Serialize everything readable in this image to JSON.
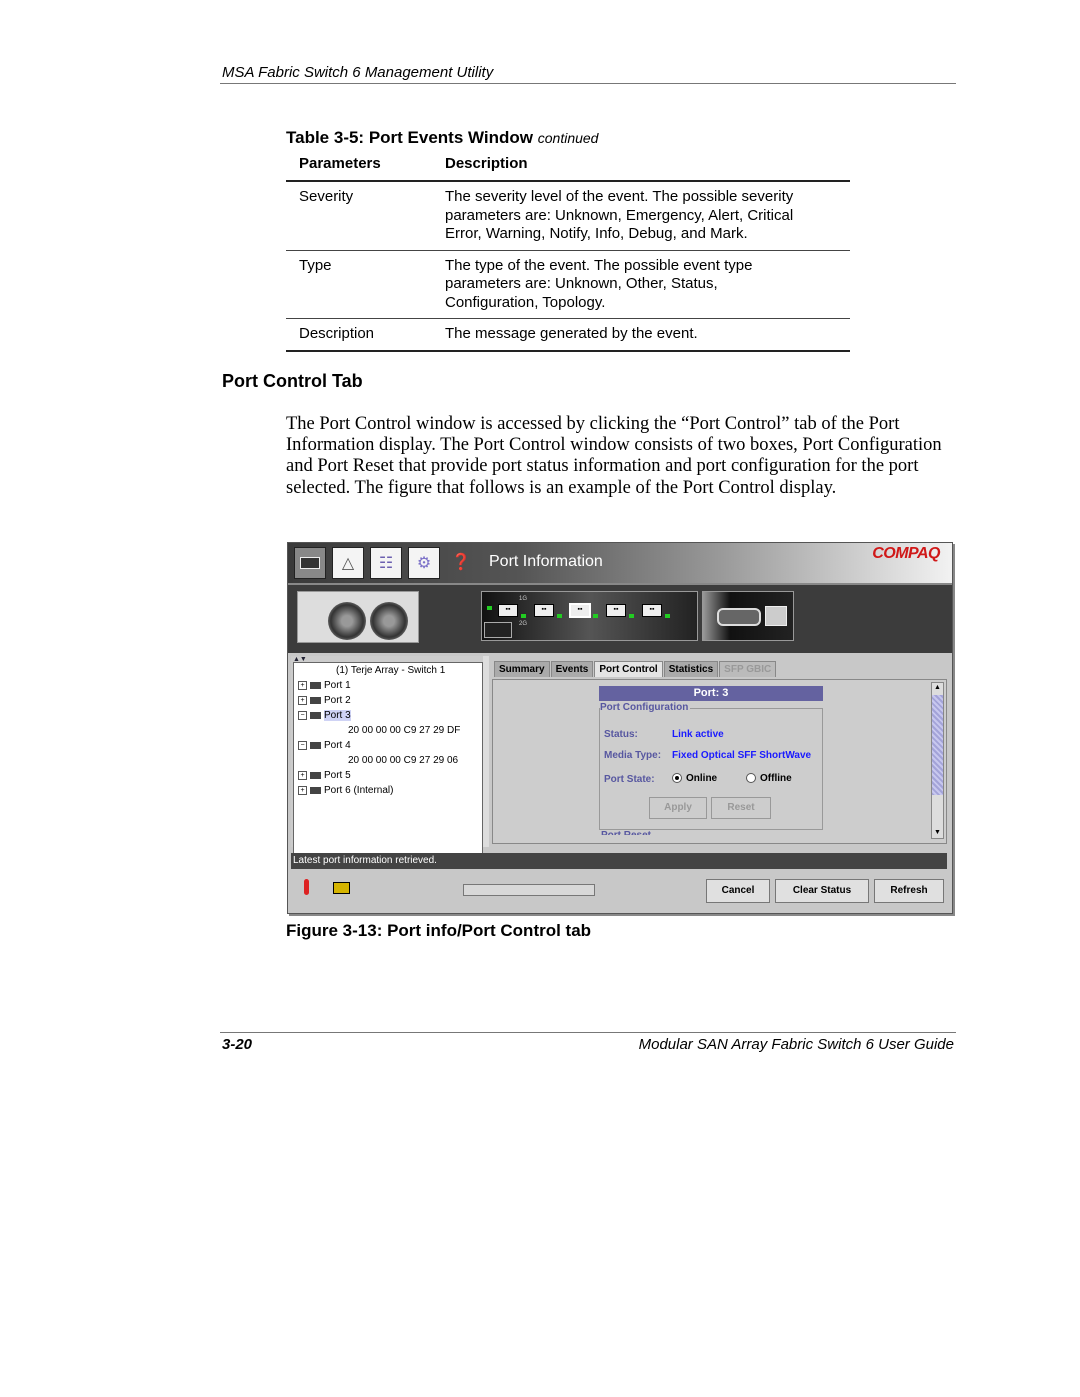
{
  "running_head": "MSA Fabric Switch 6 Management Utility",
  "table": {
    "title": "Table 3-5:  Port Events Window",
    "continued": "continued",
    "headers": [
      "Parameters",
      "Description"
    ],
    "rows": [
      {
        "param": "Severity",
        "desc": [
          "The severity level of the event. The possible severity",
          "parameters are: Unknown, Emergency, Alert, Critical",
          "Error, Warning, Notify, Info, Debug, and Mark."
        ]
      },
      {
        "param": "Type",
        "desc": [
          "The type of the event. The possible event type",
          "parameters are: Unknown, Other, Status,",
          "Configuration, Topology."
        ]
      },
      {
        "param": "Description",
        "desc": [
          "The message generated by the event."
        ]
      }
    ]
  },
  "section_heading": "Port Control Tab",
  "body_text": "The Port Control window is accessed by clicking the “Port Control” tab of the Port Information display. The Port Control window consists of two boxes, Port Configuration and Port Reset that provide port status information and port configuration for the port selected. The figure that follows is an example of the Port Control display.",
  "app": {
    "toolbar": {
      "icons": [
        "port-icon",
        "topology-icon",
        "database-icon",
        "gear-icon",
        "help-icon"
      ],
      "title": "Port Information",
      "brand": "COMPAQ",
      "brand_color": "#d01818"
    },
    "chassis": {
      "speed_labels": [
        "1G",
        "2G"
      ]
    },
    "tree": {
      "root": "(1) Terje Array - Switch 1",
      "nodes": [
        {
          "label": "Port 1",
          "expanded": false
        },
        {
          "label": "Port 2",
          "expanded": false
        },
        {
          "label": "Port 3",
          "expanded": true,
          "selected": true,
          "child": "20 00 00 00 C9 27 29 DF"
        },
        {
          "label": "Port 4",
          "expanded": true,
          "child": "20 00 00 00 C9 27 29 06"
        },
        {
          "label": "Port 5",
          "expanded": false
        },
        {
          "label": "Port 6 (Internal)",
          "expanded": false
        }
      ]
    },
    "tabs": [
      {
        "label": "Summary",
        "state": "normal"
      },
      {
        "label": "Events",
        "state": "normal"
      },
      {
        "label": "Port Control",
        "state": "active"
      },
      {
        "label": "Statistics",
        "state": "normal"
      },
      {
        "label": "SFP GBIC",
        "state": "disabled"
      }
    ],
    "port_header": "Port: 3",
    "port_config": {
      "legend": "Port Configuration",
      "status_label": "Status:",
      "status_value": "Link active",
      "media_label": "Media Type:",
      "media_value": "Fixed Optical SFF ShortWave",
      "state_label": "Port State:",
      "state_options": [
        "Online",
        "Offline"
      ],
      "state_selected": "Online",
      "apply_label": "Apply",
      "reset_label": "Reset"
    },
    "port_reset_legend": "Port Reset",
    "status_message": "Latest port information retrieved.",
    "buttons": {
      "cancel": "Cancel",
      "clear_status": "Clear Status",
      "refresh": "Refresh"
    }
  },
  "figure_caption": "Figure 3-13:  Port info/Port Control tab",
  "footer": {
    "folio": "3-20",
    "title": "Modular SAN Array Fabric Switch 6 User Guide"
  }
}
